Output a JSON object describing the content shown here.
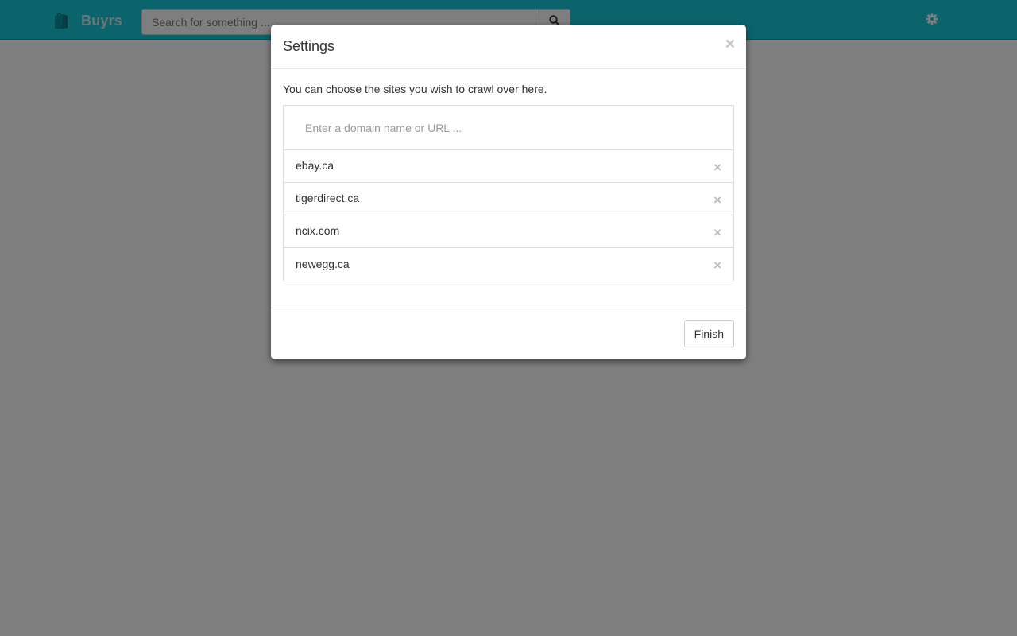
{
  "navbar": {
    "brand": "Buyrs",
    "brand_icon": "shopping-bag-icon",
    "search": {
      "placeholder": "Search for something ...",
      "value": "",
      "button_icon": "search-icon"
    },
    "settings_icon": "gear-icon"
  },
  "modal": {
    "title": "Settings",
    "close_label": "×",
    "description": "You can choose the sites you wish to crawl over here.",
    "domain_input": {
      "placeholder": "Enter a domain name or URL ...",
      "value": ""
    },
    "sites": [
      {
        "label": "ebay.ca",
        "remove": "×"
      },
      {
        "label": "tigerdirect.ca",
        "remove": "×"
      },
      {
        "label": "ncix.com",
        "remove": "×"
      },
      {
        "label": "newegg.ca",
        "remove": "×"
      }
    ],
    "finish_label": "Finish"
  },
  "colors": {
    "navbar": "#16c8d8",
    "backdrop": "rgba(0,0,0,0.5)",
    "muted_close": "#bdbdbd"
  }
}
